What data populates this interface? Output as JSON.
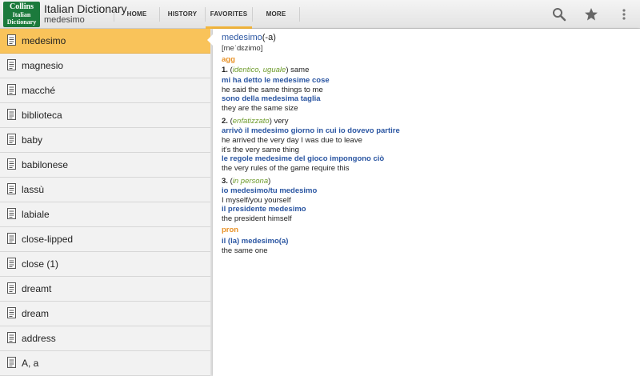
{
  "app": {
    "logo_line1": "Collins",
    "logo_line2": "Italian",
    "logo_line3": "Dictionary",
    "title": "Italian Dictionary",
    "subtitle": "medesimo"
  },
  "tabs": [
    {
      "label": "HOME"
    },
    {
      "label": "HISTORY"
    },
    {
      "label": "FAVORITES"
    },
    {
      "label": "MORE"
    }
  ],
  "colors": {
    "selected_row": "#f9c35a",
    "active_tab_indicator": "#f4b63b",
    "headword": "#2b56a2",
    "part_of_speech": "#e89228",
    "note": "#6e9b2c"
  },
  "icons": {
    "search": "search-icon",
    "favorite": "star-icon",
    "overflow": "overflow-menu-icon",
    "list_item": "document-icon"
  },
  "words": [
    "medesimo",
    "magnesio",
    "macché",
    "biblioteca",
    "baby",
    "babilonese",
    "lassù",
    "labiale",
    "close-lipped",
    "close (1)",
    "dreamt",
    "dream",
    "address",
    "A, a"
  ],
  "entry": {
    "headword": "medesimo",
    "suffix": "(-a)",
    "pronunciation": "[meˈdɛzimo]",
    "pos1": "agg",
    "s1_num": "1.",
    "s1_open": "(",
    "s1_note": "identico, uguale",
    "s1_close": ")",
    "s1_trans": "same",
    "s1_ex1": "mi ha detto le medesime cose",
    "s1_tr1": "he said the same things to me",
    "s1_ex2": "sono della medesima taglia",
    "s1_tr2": "they are the same size",
    "s2_num": "2.",
    "s2_open": "(",
    "s2_note": "enfatizzato",
    "s2_close": ")",
    "s2_trans": "very",
    "s2_ex1": "arrivò il medesimo giorno in cui io dovevo partire",
    "s2_tr1a": "he arrived the very day I was due to leave",
    "s2_tr1b": "it's the very same thing",
    "s2_ex2": "le regole medesime del gioco impongono ciò",
    "s2_tr2": "the very rules of the game require this",
    "s3_num": "3.",
    "s3_open": "(",
    "s3_note": "in persona",
    "s3_close": ")",
    "s3_ex1": "io medesimo/tu medesimo",
    "s3_tr1": "I myself/you yourself",
    "s3_ex2": "il presidente medesimo",
    "s3_tr2": "the president himself",
    "pos2": "pron",
    "p_ex1": "il (la) medesimo(a)",
    "p_tr1": "the same one"
  }
}
